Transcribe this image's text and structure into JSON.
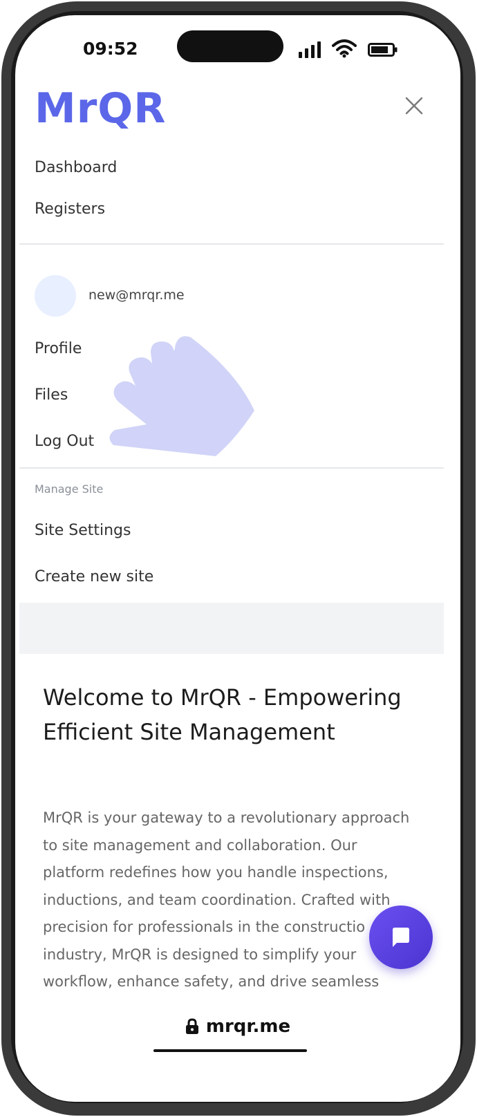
{
  "status_bar": {
    "time": "09:52",
    "icons": [
      "signal-icon",
      "wifi-icon",
      "battery-icon"
    ]
  },
  "header": {
    "logo_text": "MrQR",
    "close_icon": "close-icon"
  },
  "nav": {
    "items": [
      {
        "label": "Dashboard"
      },
      {
        "label": "Registers"
      }
    ]
  },
  "account": {
    "email": "new@mrqr.me",
    "items": [
      {
        "label": "Profile"
      },
      {
        "label": "Files"
      },
      {
        "label": "Log Out"
      }
    ]
  },
  "manage": {
    "section_label": "Manage Site",
    "items": [
      {
        "label": "Site Settings"
      },
      {
        "label": "Create new site"
      }
    ]
  },
  "welcome": {
    "title": "Welcome to MrQR - Empowering Efficient Site Management",
    "body_lines": [
      "MrQR is your gateway to a revolutionary approach",
      "to site management and collaboration. Our",
      "platform redefines how you handle inspections,",
      "inductions, and team coordination. Crafted with",
      "precision for professionals in the constructio",
      "industry, MrQR is designed to simplify your",
      "workflow, enhance safety, and drive seamless"
    ]
  },
  "chat_button": {
    "icon": "chat-icon"
  },
  "browser": {
    "url": "mrqr.me",
    "lock_icon": "lock-icon"
  },
  "colors": {
    "brand": "#5b67e8",
    "chat_fab": "#5a40e0",
    "hand_overlay": "#c9cdf7"
  }
}
